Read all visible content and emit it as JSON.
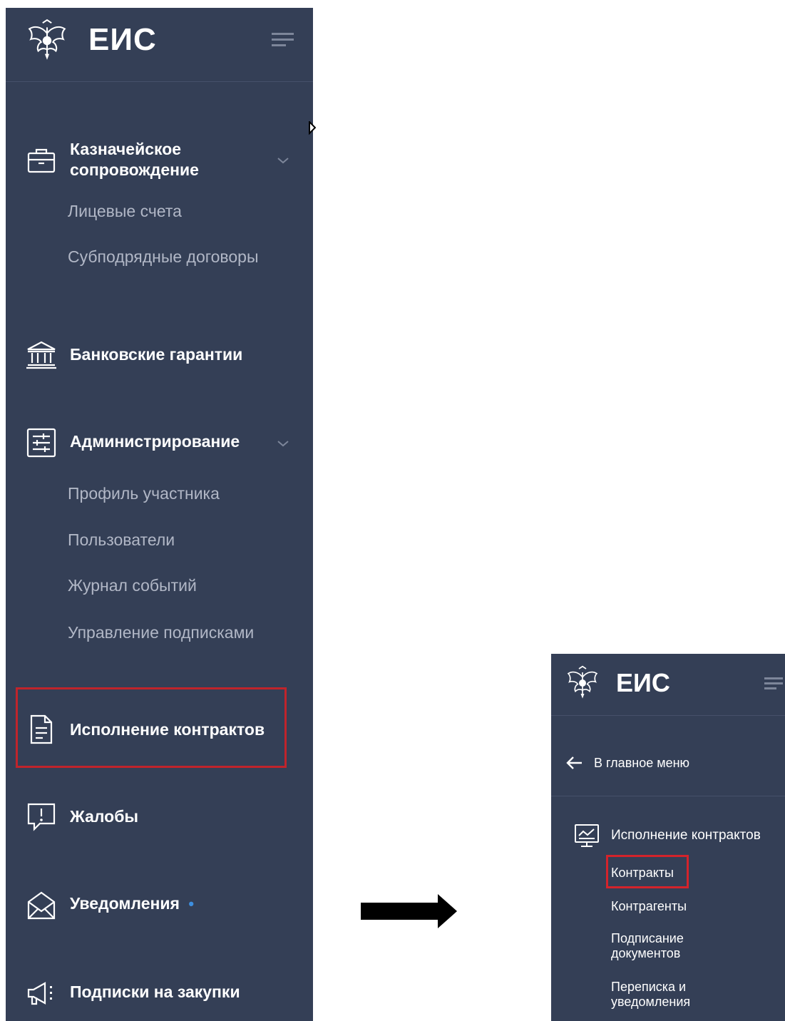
{
  "left_sidebar": {
    "logo_text": "ЕИС",
    "sections": {
      "treasury": {
        "title_line1": "Казначейское",
        "title_line2": "сопровождение",
        "items": [
          "Лицевые счета",
          "Субподрядные договоры"
        ]
      },
      "bank_guarantees": {
        "title": "Банковские гарантии"
      },
      "administration": {
        "title": "Администрирование",
        "items": [
          "Профиль участника",
          "Пользователи",
          "Журнал событий",
          "Управление подписками"
        ]
      },
      "contract_execution": {
        "title": "Исполнение контрактов",
        "highlighted": true
      },
      "complaints": {
        "title": "Жалобы"
      },
      "notifications": {
        "title": "Уведомления",
        "dot": "•"
      },
      "subscriptions": {
        "title": "Подписки на закупки"
      }
    }
  },
  "right_sidebar": {
    "logo_text": "ЕИС",
    "back_label": "В главное меню",
    "section_title": "Исполнение контрактов",
    "items": [
      "Контракты",
      "Контрагенты",
      "Подписание документов",
      "Переписка и уведомления"
    ],
    "highlighted_item": "Контракты"
  },
  "icons": {
    "logo": "coat-of-arms-icon",
    "menu": "hamburger-icon",
    "treasury": "briefcase-icon",
    "bank": "bank-icon",
    "admin": "settings-sliders-icon",
    "contracts": "document-icon",
    "complaints": "alert-message-icon",
    "notifications": "envelope-icon",
    "subscriptions": "megaphone-icon",
    "back": "arrow-left-icon",
    "contract_execution_right": "monitor-chart-icon"
  },
  "colors": {
    "sidebar_bg": "#343f56",
    "highlight": "#c0242b",
    "subitem_text": "#b1b7c6",
    "dot": "#3d8fe0"
  }
}
